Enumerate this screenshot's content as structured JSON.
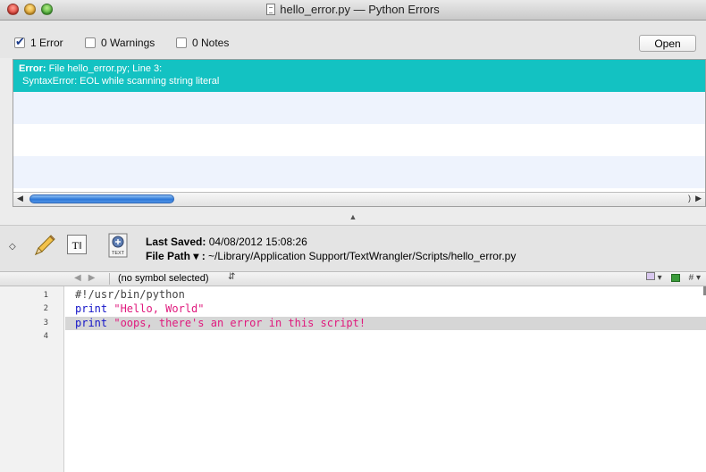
{
  "window": {
    "title": "hello_error.py — Python Errors"
  },
  "filters": {
    "errors": {
      "label": "1 Error",
      "checked": true
    },
    "warnings": {
      "label": "0 Warnings",
      "checked": false
    },
    "notes": {
      "label": "0 Notes",
      "checked": false
    },
    "open_label": "Open"
  },
  "errors": [
    {
      "head_label": "Error:",
      "head_text": "File hello_error.py; Line 3:",
      "message": "SyntaxError: EOL while scanning string literal"
    }
  ],
  "status": {
    "last_saved_label": "Last Saved:",
    "last_saved_value": "04/08/2012 15:08:26",
    "file_path_label": "File Path ▾ :",
    "file_path_value": "~/Library/Application Support/TextWrangler/Scripts/hello_error.py",
    "text_icon_label": "T‖",
    "script_icon_label": "TEXT"
  },
  "navbar": {
    "symbol": "(no symbol selected)",
    "hash": "#"
  },
  "editor": {
    "line_numbers": [
      "1",
      "2",
      "3",
      "4"
    ],
    "lines": [
      {
        "kw": "",
        "str": "",
        "plain": "#!/usr/bin/python"
      },
      {
        "kw": "print",
        "str": " \"Hello, World\"",
        "plain": ""
      },
      {
        "kw": "print",
        "str": " \"oops, there's an error in this script!",
        "plain": ""
      }
    ]
  },
  "colors": {
    "selection": "#13c2c2",
    "keyword": "#1414c8",
    "string": "#e0197d",
    "scroll_thumb": "#2d78d8"
  }
}
